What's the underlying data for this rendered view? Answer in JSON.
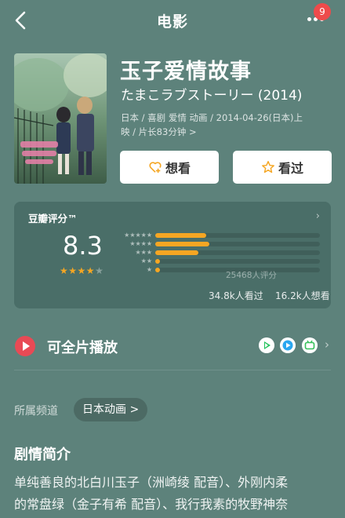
{
  "header": {
    "title": "电影",
    "badge_count": "9"
  },
  "movie": {
    "title": "玉子爱情故事",
    "subtitle": "たまこラブストーリー (2014)",
    "meta_line1": "日本 / 喜剧 爱情 动画 / 2014-04-26(日本)上",
    "meta_line2": "映 / 片长83分钟 >"
  },
  "actions": {
    "wish_label": "想看",
    "seen_label": "看过"
  },
  "rating": {
    "label": "豆瓣评分™",
    "score": "8.3",
    "stars_filled": 4,
    "stars_total": 5,
    "distribution_percent": [
      31,
      33,
      26,
      3,
      3
    ],
    "rating_count": "25468人评分",
    "watched": "34.8k人看过",
    "wishes": "16.2k人想看"
  },
  "play": {
    "label": "可全片播放",
    "providers": [
      "iqiyi-icon",
      "youku-icon",
      "bilibili-icon"
    ]
  },
  "channel": {
    "label": "所属频道",
    "tag": "日本动画 >"
  },
  "synopsis": {
    "heading": "剧情简介",
    "line1": "单纯善良的北白川玉子（洲崎绫 配音）、外刚内柔",
    "line2": "的常盘绿（金子有希 配音）、我行我素的牧野神奈"
  },
  "colors": {
    "background": "#5d827b",
    "card": "#4a6e68",
    "accent_star": "#f5a623",
    "badge": "#ee4b4b",
    "play": "#e84a55"
  }
}
